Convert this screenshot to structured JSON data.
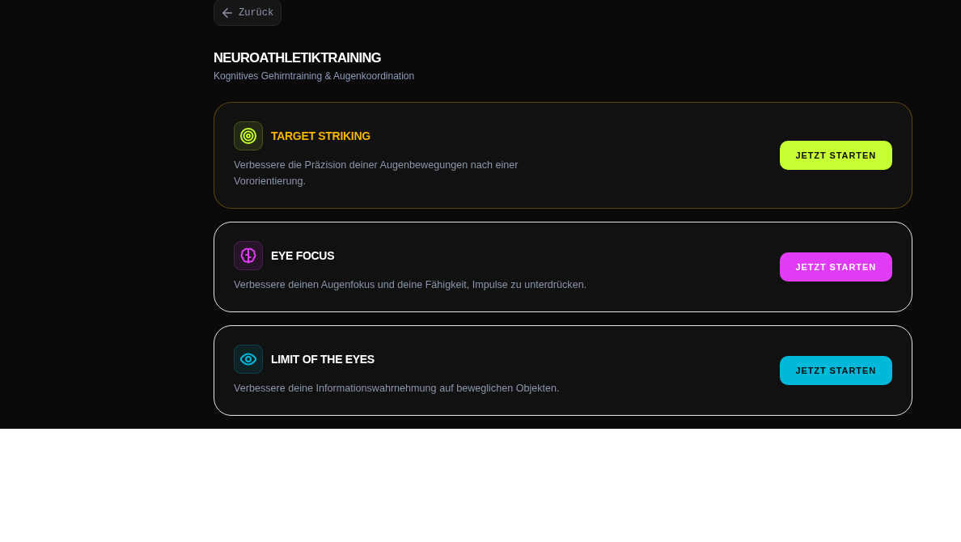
{
  "back_button": {
    "label": "Zurück"
  },
  "header": {
    "title": "NEUROATHLETIKTRAINING",
    "subtitle": "Kognitives Gehirntraining & Augenkoordination"
  },
  "cards": [
    {
      "kind": "target",
      "title": "TARGET STRIKING",
      "description": "Verbessere die Präzision deiner Augenbewegungen nach einer Vororientierung.",
      "button": "JETZT STARTEN",
      "color": "#c6ff33",
      "selected": true
    },
    {
      "kind": "brain",
      "title": "EYE FOCUS",
      "description": "Verbessere deinen Augenfokus und deine Fähigkeit, Impulse zu unterdrücken.",
      "button": "JETZT STARTEN",
      "color": "#e03cf5",
      "selected": false
    },
    {
      "kind": "eye",
      "title": "LIMIT OF THE EYES",
      "description": "Verbessere deine Informationswahrnehmung auf beweglichen Objekten.",
      "button": "JETZT STARTEN",
      "color": "#00b8d9",
      "selected": false
    }
  ]
}
